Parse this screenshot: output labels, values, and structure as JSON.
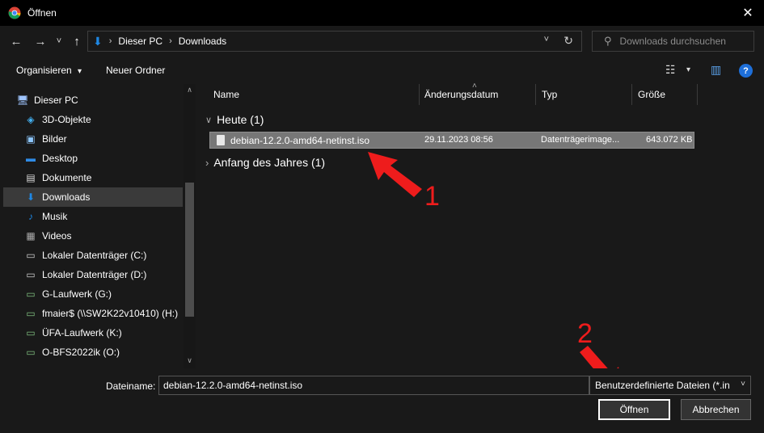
{
  "window": {
    "title": "Öffnen",
    "close_glyph": "✕"
  },
  "nav": {
    "back_glyph": "←",
    "forward_glyph": "→",
    "recent_glyph": "˅",
    "up_glyph": "↑",
    "breadcrumb": [
      "Dieser PC",
      "Downloads"
    ],
    "separator": "›",
    "refresh_glyph": "↻",
    "dropdown_glyph": "˅",
    "search_placeholder": "Downloads durchsuchen",
    "search_glyph": "⚲"
  },
  "toolbar": {
    "organize_label": "Organisieren",
    "organize_arrow": "▾",
    "new_folder_label": "Neuer Ordner",
    "view_glyph": "☷",
    "view_arrow": "▾",
    "preview_glyph": "▥",
    "help_glyph": "?"
  },
  "sidebar": {
    "items": [
      {
        "label": "Dieser PC",
        "icon": "pc-icon",
        "glyph": "🖥"
      },
      {
        "label": "3D-Objekte",
        "icon": "cube-icon",
        "glyph": "◈"
      },
      {
        "label": "Bilder",
        "icon": "pictures-icon",
        "glyph": "▣"
      },
      {
        "label": "Desktop",
        "icon": "desktop-icon",
        "glyph": "▬"
      },
      {
        "label": "Dokumente",
        "icon": "documents-icon",
        "glyph": "▤"
      },
      {
        "label": "Downloads",
        "icon": "download-arrow-icon",
        "glyph": "⬇"
      },
      {
        "label": "Musik",
        "icon": "music-icon",
        "glyph": "♪"
      },
      {
        "label": "Videos",
        "icon": "video-icon",
        "glyph": "▦"
      },
      {
        "label": "Lokaler Datenträger (C:)",
        "icon": "drive-icon",
        "glyph": "▭"
      },
      {
        "label": "Lokaler Datenträger (D:)",
        "icon": "drive-icon",
        "glyph": "▭"
      },
      {
        "label": "G-Laufwerk (G:)",
        "icon": "network-drive-icon",
        "glyph": "▭"
      },
      {
        "label": "fmaier$ (\\\\SW2K22v10410) (H:)",
        "icon": "network-drive-icon",
        "glyph": "▭"
      },
      {
        "label": "ÜFA-Laufwerk (K:)",
        "icon": "network-drive-icon",
        "glyph": "▭"
      },
      {
        "label": "O-BFS2022ik (O:)",
        "icon": "network-drive-icon",
        "glyph": "▭"
      }
    ],
    "active_index": 5
  },
  "columns": {
    "name": "Name",
    "date": "Änderungsdatum",
    "type": "Typ",
    "size": "Größe",
    "sort_glyph": "˄"
  },
  "groups": [
    {
      "label": "Heute (1)",
      "chevron": "∨"
    },
    {
      "label": "Anfang des Jahres (1)",
      "chevron": "›"
    }
  ],
  "file": {
    "name": "debian-12.2.0-amd64-netinst.iso",
    "date": "29.11.2023 08:56",
    "type": "Datenträgerimage...",
    "size": "643.072 KB"
  },
  "bottom": {
    "filename_label": "Dateiname:",
    "filename_value": "debian-12.2.0-amd64-netinst.iso",
    "filter_value": "Benutzerdefinierte Dateien (*.in",
    "filter_arrow": "˅",
    "open_label": "Öffnen",
    "cancel_label": "Abbrechen"
  },
  "annotations": {
    "step1": "1",
    "step2": "2",
    "arrow_color": "#ee1c1c"
  }
}
